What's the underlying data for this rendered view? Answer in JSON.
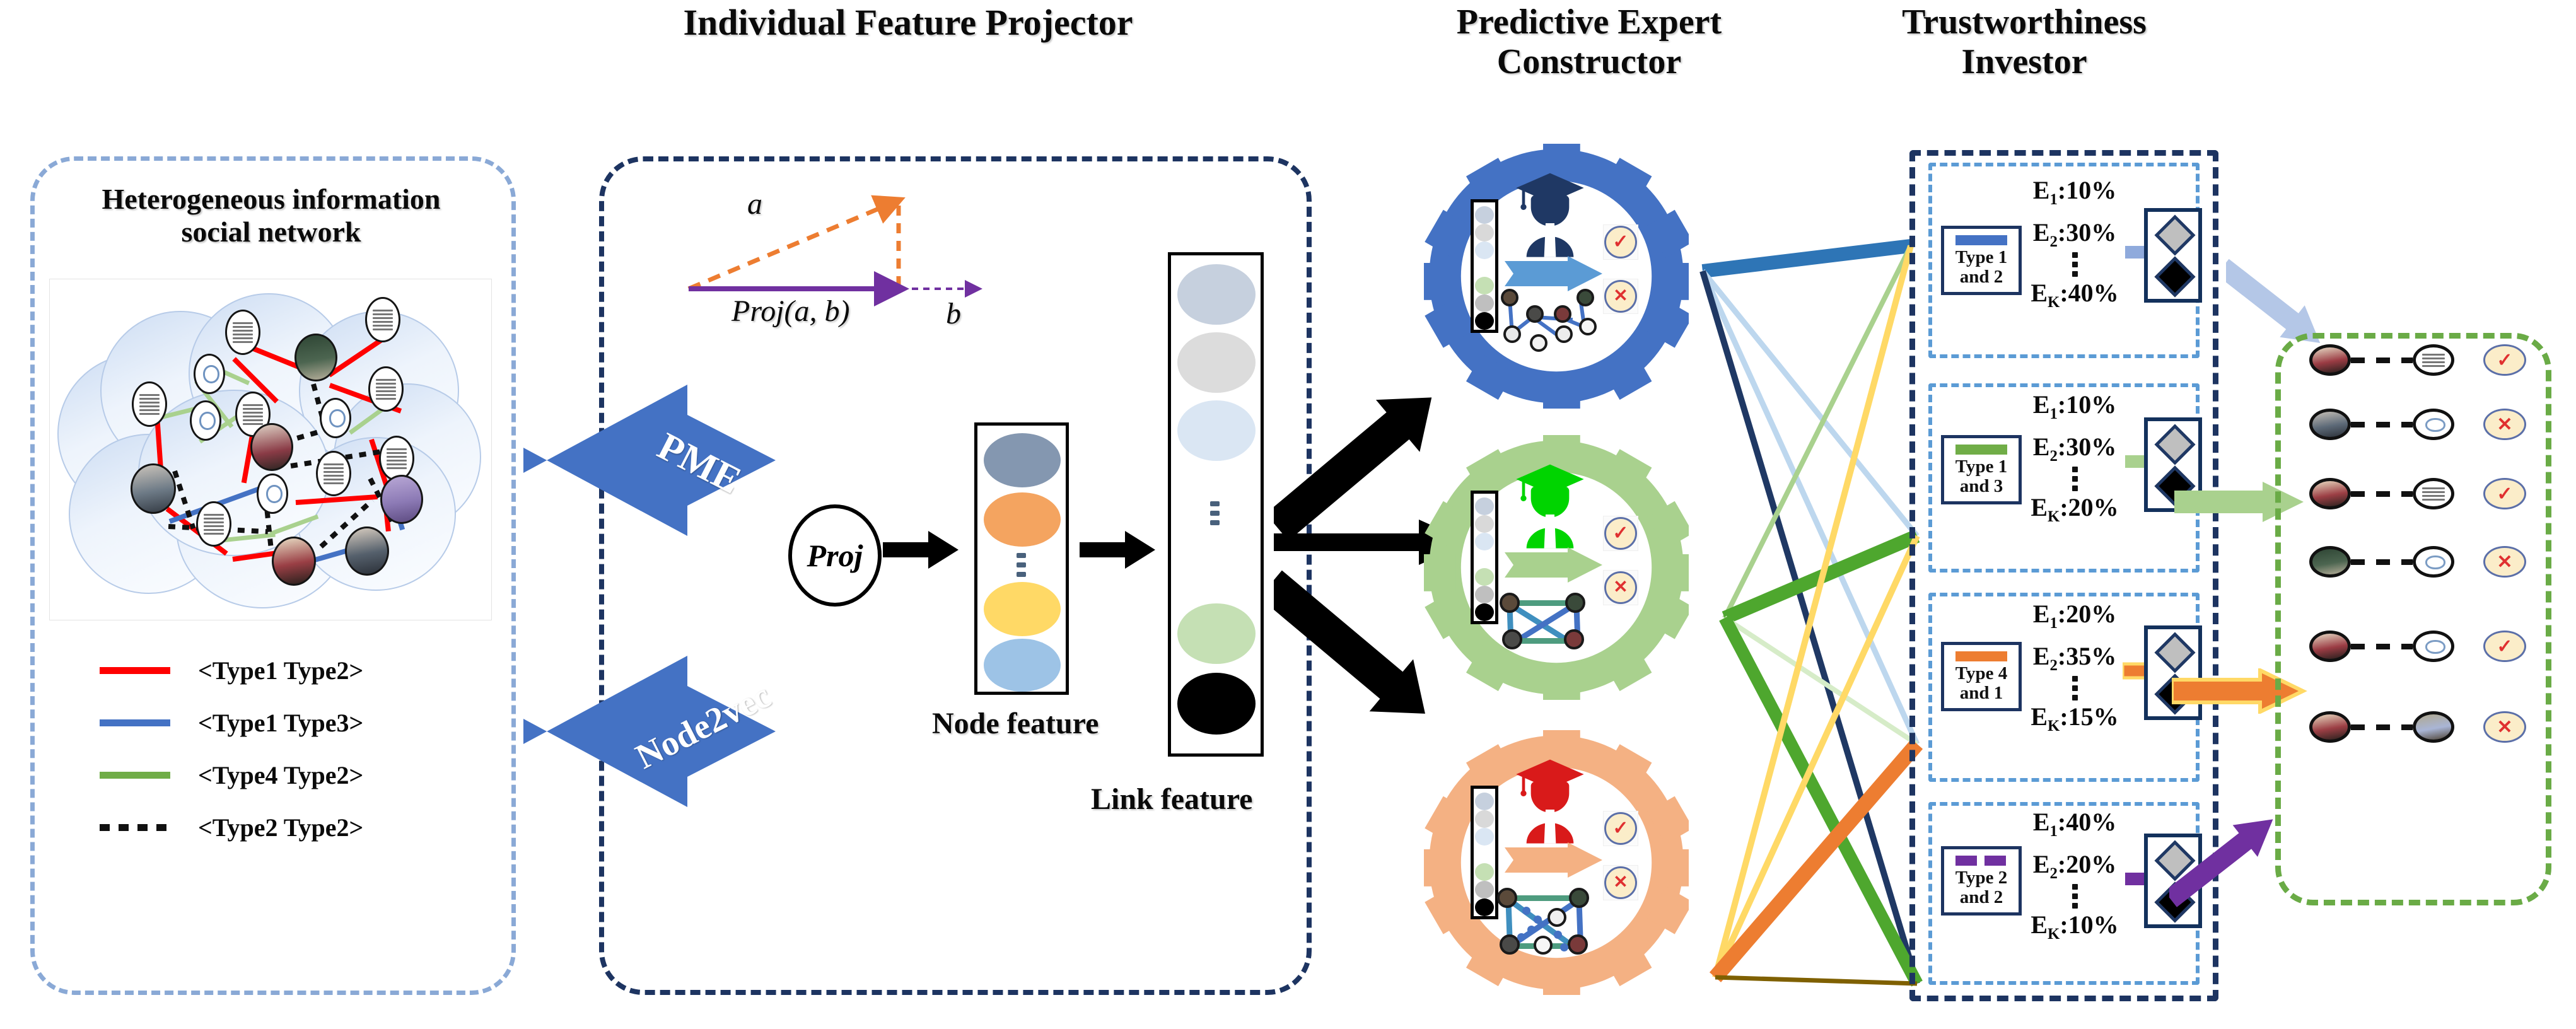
{
  "sections": {
    "left_title_line1": "Heterogeneous information",
    "left_title_line2": "social network",
    "projector_title": "Individual Feature Projector",
    "expert_title_line1": "Predictive Expert",
    "expert_title_line2": "Constructor",
    "trust_title_line1": "Trustworthiness",
    "trust_title_line2": "Investor"
  },
  "legend": {
    "items": [
      {
        "label": "<Type1 Type2>",
        "color": "#ff0000",
        "style": "solid"
      },
      {
        "label": "<Type1 Type3>",
        "color": "#4472c4",
        "style": "solid"
      },
      {
        "label": "<Type4 Type2>",
        "color": "#70ad47",
        "style": "solid"
      },
      {
        "label": "<Type2 Type2>",
        "color": "#111111",
        "style": "dotted"
      }
    ]
  },
  "projector": {
    "vector_a_label": "a",
    "vector_b_label": "b",
    "proj_label": "Proj(a, b)",
    "proj_node_label": "Proj",
    "node_feature_caption": "Node feature",
    "link_feature_caption": "Link feature",
    "node_feature_colors": [
      "#8497b0",
      "#f4a460",
      "#ffd966",
      "#9dc3e6"
    ],
    "link_feature_colors": [
      "#c6d0de",
      "#dcdcdc",
      "#dae6f3",
      "#c5e0b4",
      "#000000"
    ],
    "vector_colors": {
      "a": "#ed7d31",
      "b": "#7030a0"
    }
  },
  "experts": [
    {
      "name": "expert-1",
      "gear_color": "#4472c4",
      "cap_color": "#1f3864",
      "arrow_color": "#5b9bd5",
      "vector_colors": [
        "#c6d0de",
        "#d9d9d9",
        "#dae6f3",
        "#ffffff",
        "#c5e0b4",
        "#bfbfbf",
        "#000000"
      ],
      "check_glyph": "✓",
      "cross_glyph": "✕"
    },
    {
      "name": "expert-2",
      "gear_color": "#a9d18e",
      "cap_color": "#00d400",
      "arrow_color": "#a9d18e",
      "vector_colors": [
        "#c6d0de",
        "#d9d9d9",
        "#dae6f3",
        "#ffffff",
        "#c5e0b4",
        "#bfbfbf",
        "#000000"
      ],
      "check_glyph": "✓",
      "cross_glyph": "✕"
    },
    {
      "name": "expert-3",
      "gear_color": "#f4b183",
      "cap_color": "#d91a1a",
      "arrow_color": "#f4b183",
      "vector_colors": [
        "#c6d0de",
        "#d9d9d9",
        "#dae6f3",
        "#ffffff",
        "#c5e0b4",
        "#bfbfbf",
        "#000000"
      ],
      "check_glyph": "✓",
      "cross_glyph": "✕"
    }
  ],
  "trust_boxes": [
    {
      "type_label_line1": "Type 1",
      "type_label_line2": "and 2",
      "swatch_color": "#4472c4",
      "swatch_style": "solid",
      "arrow_color": "#8faadc",
      "e1": "E₁:10%",
      "e2": "E₂:30%",
      "ek": "Eₖ:40%",
      "e1_label": "E",
      "e1_sub": "1",
      "e1_val": ":10%",
      "e2_label": "E",
      "e2_sub": "2",
      "e2_val": ":30%",
      "ek_label": "E",
      "ek_sub": "K",
      "ek_val": ":40%"
    },
    {
      "type_label_line1": "Type 1",
      "type_label_line2": "and 3",
      "swatch_color": "#70ad47",
      "swatch_style": "solid",
      "arrow_color": "#a9d18e",
      "e1_label": "E",
      "e1_sub": "1",
      "e1_val": ":10%",
      "e2_label": "E",
      "e2_sub": "2",
      "e2_val": ":30%",
      "ek_label": "E",
      "ek_sub": "K",
      "ek_val": ":20%"
    },
    {
      "type_label_line1": "Type 4",
      "type_label_line2": "and 1",
      "swatch_color": "#ed7d31",
      "swatch_style": "solid",
      "arrow_color": "#ed7d31",
      "e1_label": "E",
      "e1_sub": "1",
      "e1_val": ":20%",
      "e2_label": "E",
      "e2_sub": "2",
      "e2_val": ":35%",
      "ek_label": "E",
      "ek_sub": "K",
      "ek_val": ":15%"
    },
    {
      "type_label_line1": "Type 2",
      "type_label_line2": "and 2",
      "swatch_color": "#7030a0",
      "swatch_style": "dashed",
      "arrow_color": "#7030a0",
      "e1_label": "E",
      "e1_sub": "1",
      "e1_val": ":40%",
      "e2_label": "E",
      "e2_sub": "2",
      "e2_val": ":20%",
      "ek_label": "E",
      "ek_sub": "K",
      "ek_val": ":10%"
    }
  ],
  "output_rows": [
    {
      "left": "person-photo",
      "right": "text-note",
      "result": "check"
    },
    {
      "left": "person-photo",
      "right": "speech-bubble",
      "result": "cross"
    },
    {
      "left": "person-photo",
      "right": "text-note",
      "result": "check"
    },
    {
      "left": "person-photo",
      "right": "speech-bubble",
      "result": "cross"
    },
    {
      "left": "person-photo",
      "right": "speech-bubble",
      "result": "check"
    },
    {
      "left": "person-photo",
      "right": "person-photo",
      "result": "cross"
    }
  ],
  "output_glyphs": {
    "check": "✓",
    "cross": "✕"
  },
  "flow_arrows": {
    "pme_label": "PME",
    "node2vec_label": "Node2vec",
    "final_arrow_colors": [
      "#b4c7e7",
      "#a9d18e",
      "#ed7d31",
      "#7030a0"
    ]
  },
  "colors": {
    "panel_lightblue": "#8aa9d6",
    "panel_navy": "#1d3461",
    "panel_green": "#6aab46",
    "blue_arrow": "#4472c4"
  }
}
